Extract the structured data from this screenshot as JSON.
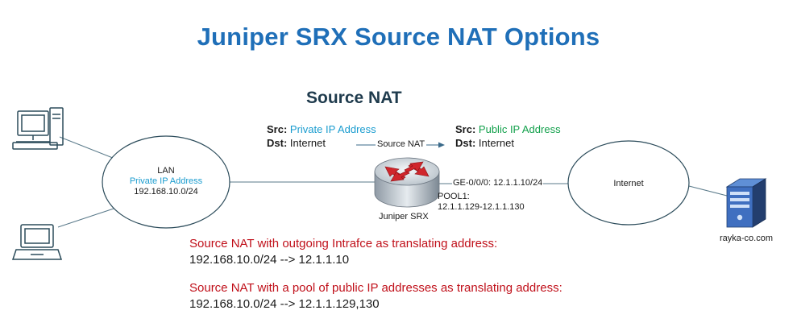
{
  "title": "Juniper SRX Source NAT Options",
  "subtitle": "Source NAT",
  "lan": {
    "name": "LAN",
    "subnet_label": "Private IP Address",
    "subnet": "192.168.10.0/24"
  },
  "internet": {
    "name": "Internet"
  },
  "router": {
    "name": "Juniper SRX",
    "interface": "GE-0/0/0: 12.1.1.10/24",
    "pool_name": "POOL1:",
    "pool_range": "12.1.1.129-12.1.1.130"
  },
  "server": {
    "name": "rayka-co.com"
  },
  "before": {
    "src_key": "Src",
    "src_value": "Private IP Address",
    "dst_key": "Dst",
    "dst_value": "Internet"
  },
  "after": {
    "src_key": "Src",
    "src_value": "Public IP Address",
    "dst_key": "Dst",
    "dst_value": "Internet"
  },
  "arrow_label": "Source NAT",
  "options": [
    {
      "heading": "Source NAT with outgoing Intrafce as translating address:",
      "mapping": "192.168.10.0/24 --> 12.1.1.10"
    },
    {
      "heading": "Source NAT with a pool of public IP addresses as translating address:",
      "mapping": "192.168.10.0/24 --> 12.1.1.129,130"
    }
  ],
  "colors": {
    "title": "#1f6fb8",
    "private": "#1a9ccf",
    "public": "#12a04b",
    "option_heading": "#c0101a",
    "router_red": "#d0262c"
  }
}
